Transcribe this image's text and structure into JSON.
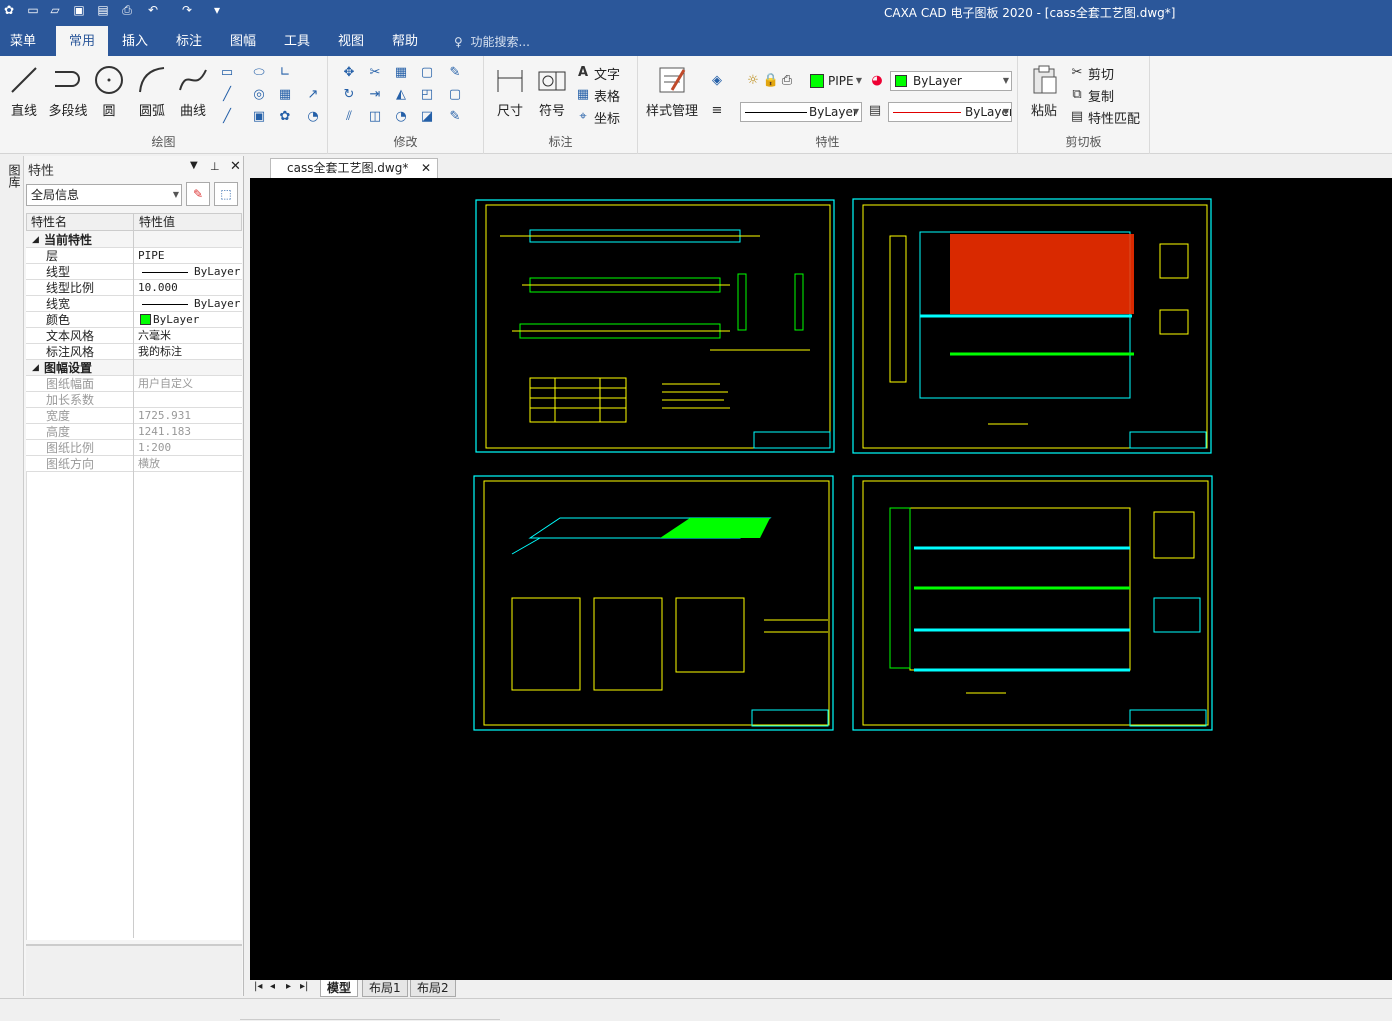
{
  "window": {
    "title": "CAXA CAD 电子图板 2020 - [cass全套工艺图.dwg*]"
  },
  "menu": {
    "tabs": [
      "菜单",
      "常用",
      "插入",
      "标注",
      "图幅",
      "工具",
      "视图",
      "帮助"
    ],
    "active": "常用",
    "search": "功能搜索..."
  },
  "ribbon": {
    "draw": {
      "name": "绘图",
      "line": "直线",
      "polyline": "多段线",
      "circle": "圆",
      "arc": "圆弧",
      "curve": "曲线"
    },
    "modify": {
      "name": "修改"
    },
    "annotate": {
      "name": "标注",
      "dimension": "尺寸",
      "symbol": "符号",
      "text": "文字",
      "table": "表格",
      "coord": "坐标"
    },
    "props": {
      "name": "特性",
      "style_mgr": "样式管理",
      "layer": "PIPE",
      "color": "ByLayer",
      "linetype": "ByLayer",
      "lineweight": "ByLayer"
    },
    "clipboard": {
      "name": "剪切板",
      "paste": "粘贴",
      "cut": "剪切",
      "copy": "复制",
      "match": "特性匹配"
    }
  },
  "side_strip_label": "图库",
  "panel": {
    "title": "特性",
    "selector": "全局信息",
    "col_name": "特性名",
    "col_value": "特性值",
    "rows": [
      {
        "k": "当前特性",
        "v": "",
        "type": "sec"
      },
      {
        "k": "层",
        "v": "PIPE"
      },
      {
        "k": "线型",
        "v": "ByLayer",
        "line": true
      },
      {
        "k": "线型比例",
        "v": "10.000"
      },
      {
        "k": "线宽",
        "v": "ByLayer",
        "line": true
      },
      {
        "k": "颜色",
        "v": "ByLayer",
        "swatch": "#00ff00"
      },
      {
        "k": "文本风格",
        "v": "六毫米"
      },
      {
        "k": "标注风格",
        "v": "我的标注"
      },
      {
        "k": "图幅设置",
        "v": "",
        "type": "sec"
      },
      {
        "k": "图纸幅面",
        "v": "用户自定义",
        "type": "dis"
      },
      {
        "k": "加长系数",
        "v": "",
        "type": "dis"
      },
      {
        "k": "宽度",
        "v": "1725.931",
        "type": "dis"
      },
      {
        "k": "高度",
        "v": "1241.183",
        "type": "dis"
      },
      {
        "k": "图纸比例",
        "v": "1:200",
        "type": "dis"
      },
      {
        "k": "图纸方向",
        "v": "横放",
        "type": "dis"
      }
    ]
  },
  "doc_tab": "cass全套工艺图.dwg*",
  "layout_tabs": [
    "模型",
    "布局1",
    "布局2"
  ],
  "colors": {
    "accent": "#2b579a",
    "canvas": "#000000",
    "border": "#00ffff",
    "drawing": "#ffff00",
    "fill": "#00ff00",
    "hatch": "#ff0000"
  }
}
